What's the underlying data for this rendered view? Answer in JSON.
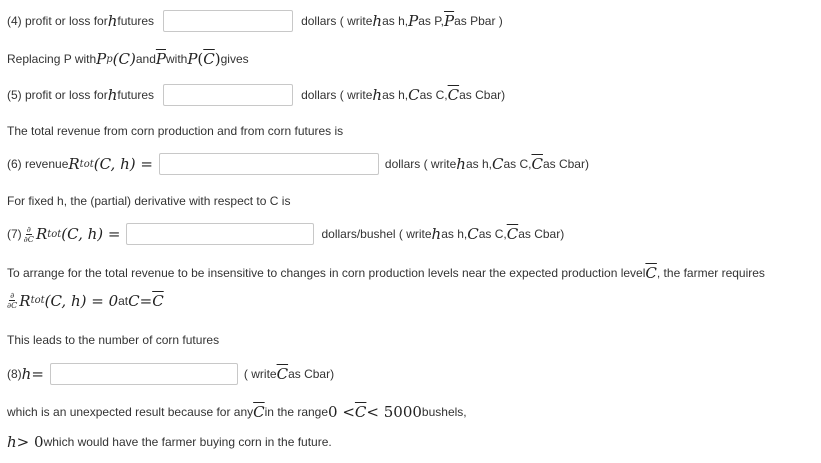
{
  "q4": {
    "label": "(4) profit or loss for ",
    "var": "h",
    "label_tail": " futures",
    "value": "",
    "hint_pre": "dollars ( write ",
    "hint_h": "h",
    "hint_mid1": " as h, ",
    "hint_P": "P",
    "hint_mid2": " as P, ",
    "hint_Pbar": "P",
    "hint_tail": " as Pbar )"
  },
  "replacing": {
    "pre": "Replacing P with ",
    "Pp": "P",
    "p_sub": "p",
    "C_arg": "(C)",
    "and": " and ",
    "Pbar": "P",
    "with": " with ",
    "P2": "P",
    "Cbar_open": "(",
    "Cbar": "C",
    "Cbar_close": ")",
    "gives": " gives"
  },
  "q5": {
    "label": "(5) profit or loss for ",
    "var": "h",
    "label_tail": " futures",
    "value": "",
    "hint_pre": "dollars ( write ",
    "hint_h": "h",
    "hint_mid1": " as h, ",
    "hint_C": "C",
    "hint_mid2": " as C, ",
    "hint_Cbar": "C",
    "hint_tail": " as Cbar)"
  },
  "total_revenue_text": "The total revenue from corn production and from corn futures is",
  "q6": {
    "label": "(6) revenue ",
    "R": "R",
    "sub": "tot",
    "args": "(C, h) =",
    "value": "",
    "hint_pre": "dollars ( write ",
    "hint_h": "h",
    "hint_mid1": " as h, ",
    "hint_C": "C",
    "hint_mid2": " as C, ",
    "hint_Cbar": "C",
    "hint_tail": " as Cbar)"
  },
  "fixed_h_text": "For fixed h, the (partial) derivative with respect to C is",
  "q7": {
    "label": "(7) ",
    "frac_num": "∂",
    "frac_den": "∂C",
    "R": "R",
    "sub": "tot",
    "args": "(C, h) =",
    "value": "",
    "hint_pre": "dollars/bushel ( write ",
    "hint_h": "h",
    "hint_mid1": " as h, ",
    "hint_C": "C",
    "hint_mid2": " as C, ",
    "hint_Cbar": "C",
    "hint_tail": " as Cbar)"
  },
  "arrange": {
    "text_pre": "To arrange for the total revenue to be insensitive to changes in corn production levels near the expected production level ",
    "Cbar": "C",
    "text_tail": ", the farmer requires"
  },
  "requires": {
    "frac_num": "∂",
    "frac_den": "∂C",
    "R": "R",
    "sub": "tot",
    "args": "(C, h) = 0",
    "at": " at ",
    "C": "C",
    "eq": " = ",
    "Cbar": "C"
  },
  "leads_text": "This leads to the number of corn futures",
  "q8": {
    "label": "(8) ",
    "h": "h",
    "eq": " =",
    "value": "",
    "hint_pre": "( write ",
    "hint_Cbar": "C",
    "hint_tail": " as Cbar)"
  },
  "unexpected": {
    "pre": "which is an unexpected result because for any ",
    "Cbar": "C",
    "mid": " in the range ",
    "range_a": "0 < ",
    "range_Cbar": "C",
    "range_b": " < 5000",
    "tail": " bushels,"
  },
  "final": {
    "h": "h",
    "gt": " > 0",
    "tail": " which would have the farmer buying corn in the future."
  }
}
